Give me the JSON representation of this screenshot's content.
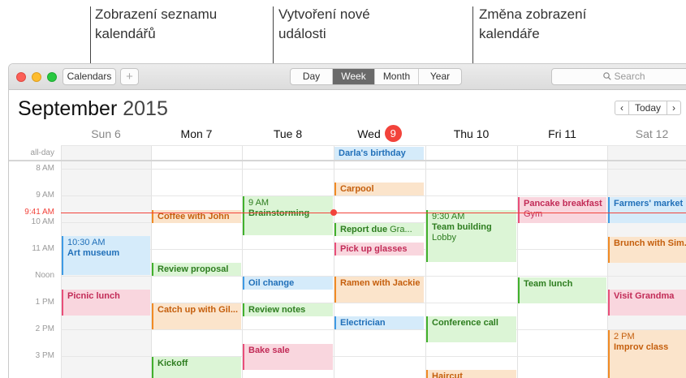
{
  "callouts": {
    "list": [
      "Zobrazení seznamu",
      "kalendářů"
    ],
    "create": [
      "Vytvoření nové",
      "události"
    ],
    "change": [
      "Změna zobrazení",
      "kalendáře"
    ]
  },
  "toolbar": {
    "calendars_label": "Calendars",
    "add_label": "+",
    "views": [
      "Day",
      "Week",
      "Month",
      "Year"
    ],
    "active_view": "Week",
    "search_placeholder": "Search"
  },
  "header": {
    "month": "September",
    "year": "2015",
    "today_label": "Today",
    "prev_icon": "‹",
    "next_icon": "›"
  },
  "days": [
    {
      "label": "Sun 6"
    },
    {
      "label": "Mon 7"
    },
    {
      "label": "Tue 8"
    },
    {
      "label": "Wed",
      "badge": "9"
    },
    {
      "label": "Thu 10"
    },
    {
      "label": "Fri 11"
    },
    {
      "label": "Sat 12"
    }
  ],
  "hours": {
    "allday": "all-day",
    "h8": "8 AM",
    "h9": "9 AM",
    "h10": "10 AM",
    "h11": "11 AM",
    "noon": "Noon",
    "h1": "1 PM",
    "h2": "2 PM",
    "h3": "3 PM"
  },
  "now_label": "9:41 AM",
  "events": {
    "birthday": "Darla's birthday",
    "carpool": "Carpool",
    "pancake": "Pancake breakfast",
    "pancake_sub": "Gym",
    "farmers": "Farmers' market",
    "brainstorm_time": "9 AM",
    "brainstorm": "Brainstorming",
    "coffee": "Coffee with John",
    "report": "Report due",
    "report_sub": "Gra...",
    "teambuild_time": "9:30 AM",
    "teambuild": "Team building",
    "teambuild_sub": "Lobby",
    "artmuseum_time": "10:30 AM",
    "artmuseum": "Art museum",
    "glasses": "Pick up glasses",
    "brunch": "Brunch with Sim...",
    "review": "Review proposal",
    "oil": "Oil change",
    "ramen": "Ramen with Jackie",
    "teamlunch": "Team lunch",
    "picnic": "Picnic lunch",
    "catchup": "Catch up with Gil...",
    "reviewnotes": "Review notes",
    "grandma": "Visit Grandma",
    "electrician": "Electrician",
    "conference": "Conference call",
    "improv_time": "2 PM",
    "improv": "Improv class",
    "bakesale": "Bake sale",
    "kickoff": "Kickoff",
    "haircut": "Haircut"
  },
  "colors": {
    "blue": "#3e9ae4",
    "green": "#41b02c",
    "orange": "#f08a24",
    "pink": "#e94e79",
    "today_red": "#f2433b"
  }
}
